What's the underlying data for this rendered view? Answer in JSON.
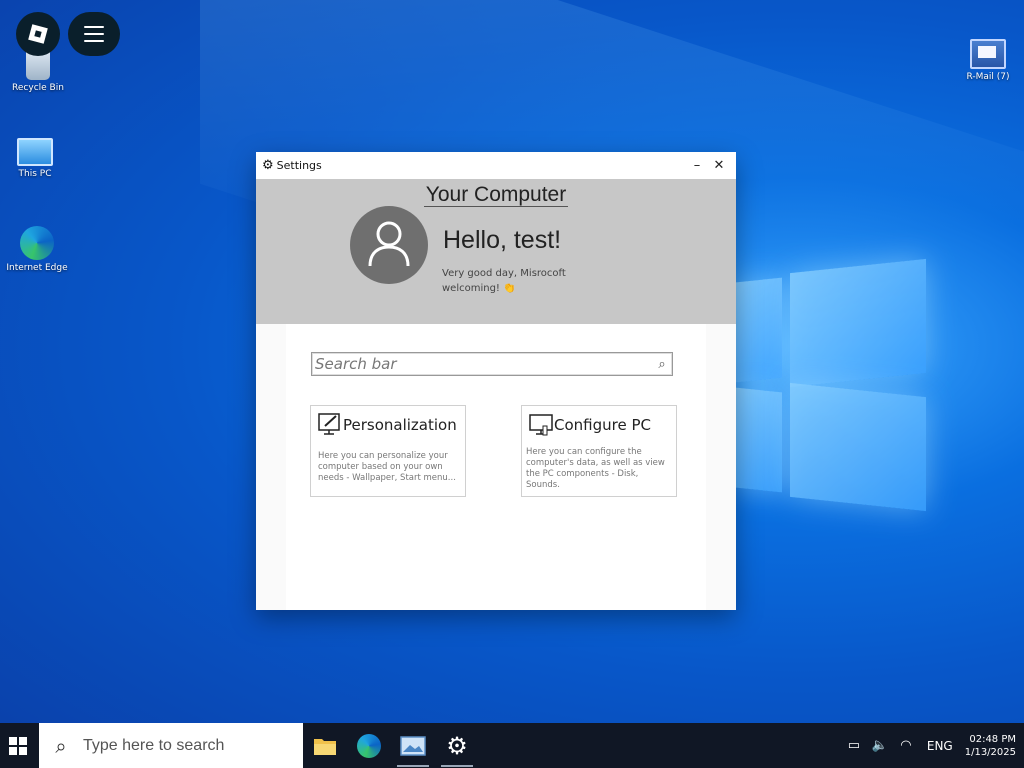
{
  "overlay": {
    "roblox_icon": "roblox-icon",
    "menu_icon": "hamburger-menu-icon"
  },
  "desktop": {
    "icons": [
      {
        "label": "Recycle Bin"
      },
      {
        "label": "This PC"
      },
      {
        "label": "Internet Edge"
      },
      {
        "label": "R-Mail (7)"
      }
    ]
  },
  "settings_window": {
    "title": "Settings",
    "minimize": "–",
    "close": "✕",
    "heading": "Your Computer",
    "greeting": "Hello, test!",
    "welcome_text": "Very good day, Misrocoft welcoming! 👏",
    "search_placeholder": "Search bar",
    "cards": [
      {
        "title": "Personalization",
        "desc": "Here you can personalize your computer based on your own needs - Wallpaper, Start menu..."
      },
      {
        "title": "Configure PC",
        "desc": "Here you can configure the computer's data, as well as view the PC components - Disk, Sounds."
      }
    ]
  },
  "taskbar": {
    "search_placeholder": "Type here to search",
    "apps": [
      "file-explorer-icon",
      "edge-icon",
      "photos-icon",
      "settings-icon"
    ],
    "tray": {
      "language": "ENG",
      "time": "02:48 PM",
      "date": "1/13/2025"
    }
  },
  "colors": {
    "taskbar": "#101725",
    "hero": "#c7c7c7",
    "desktop_blue": "#0a6fe0"
  }
}
